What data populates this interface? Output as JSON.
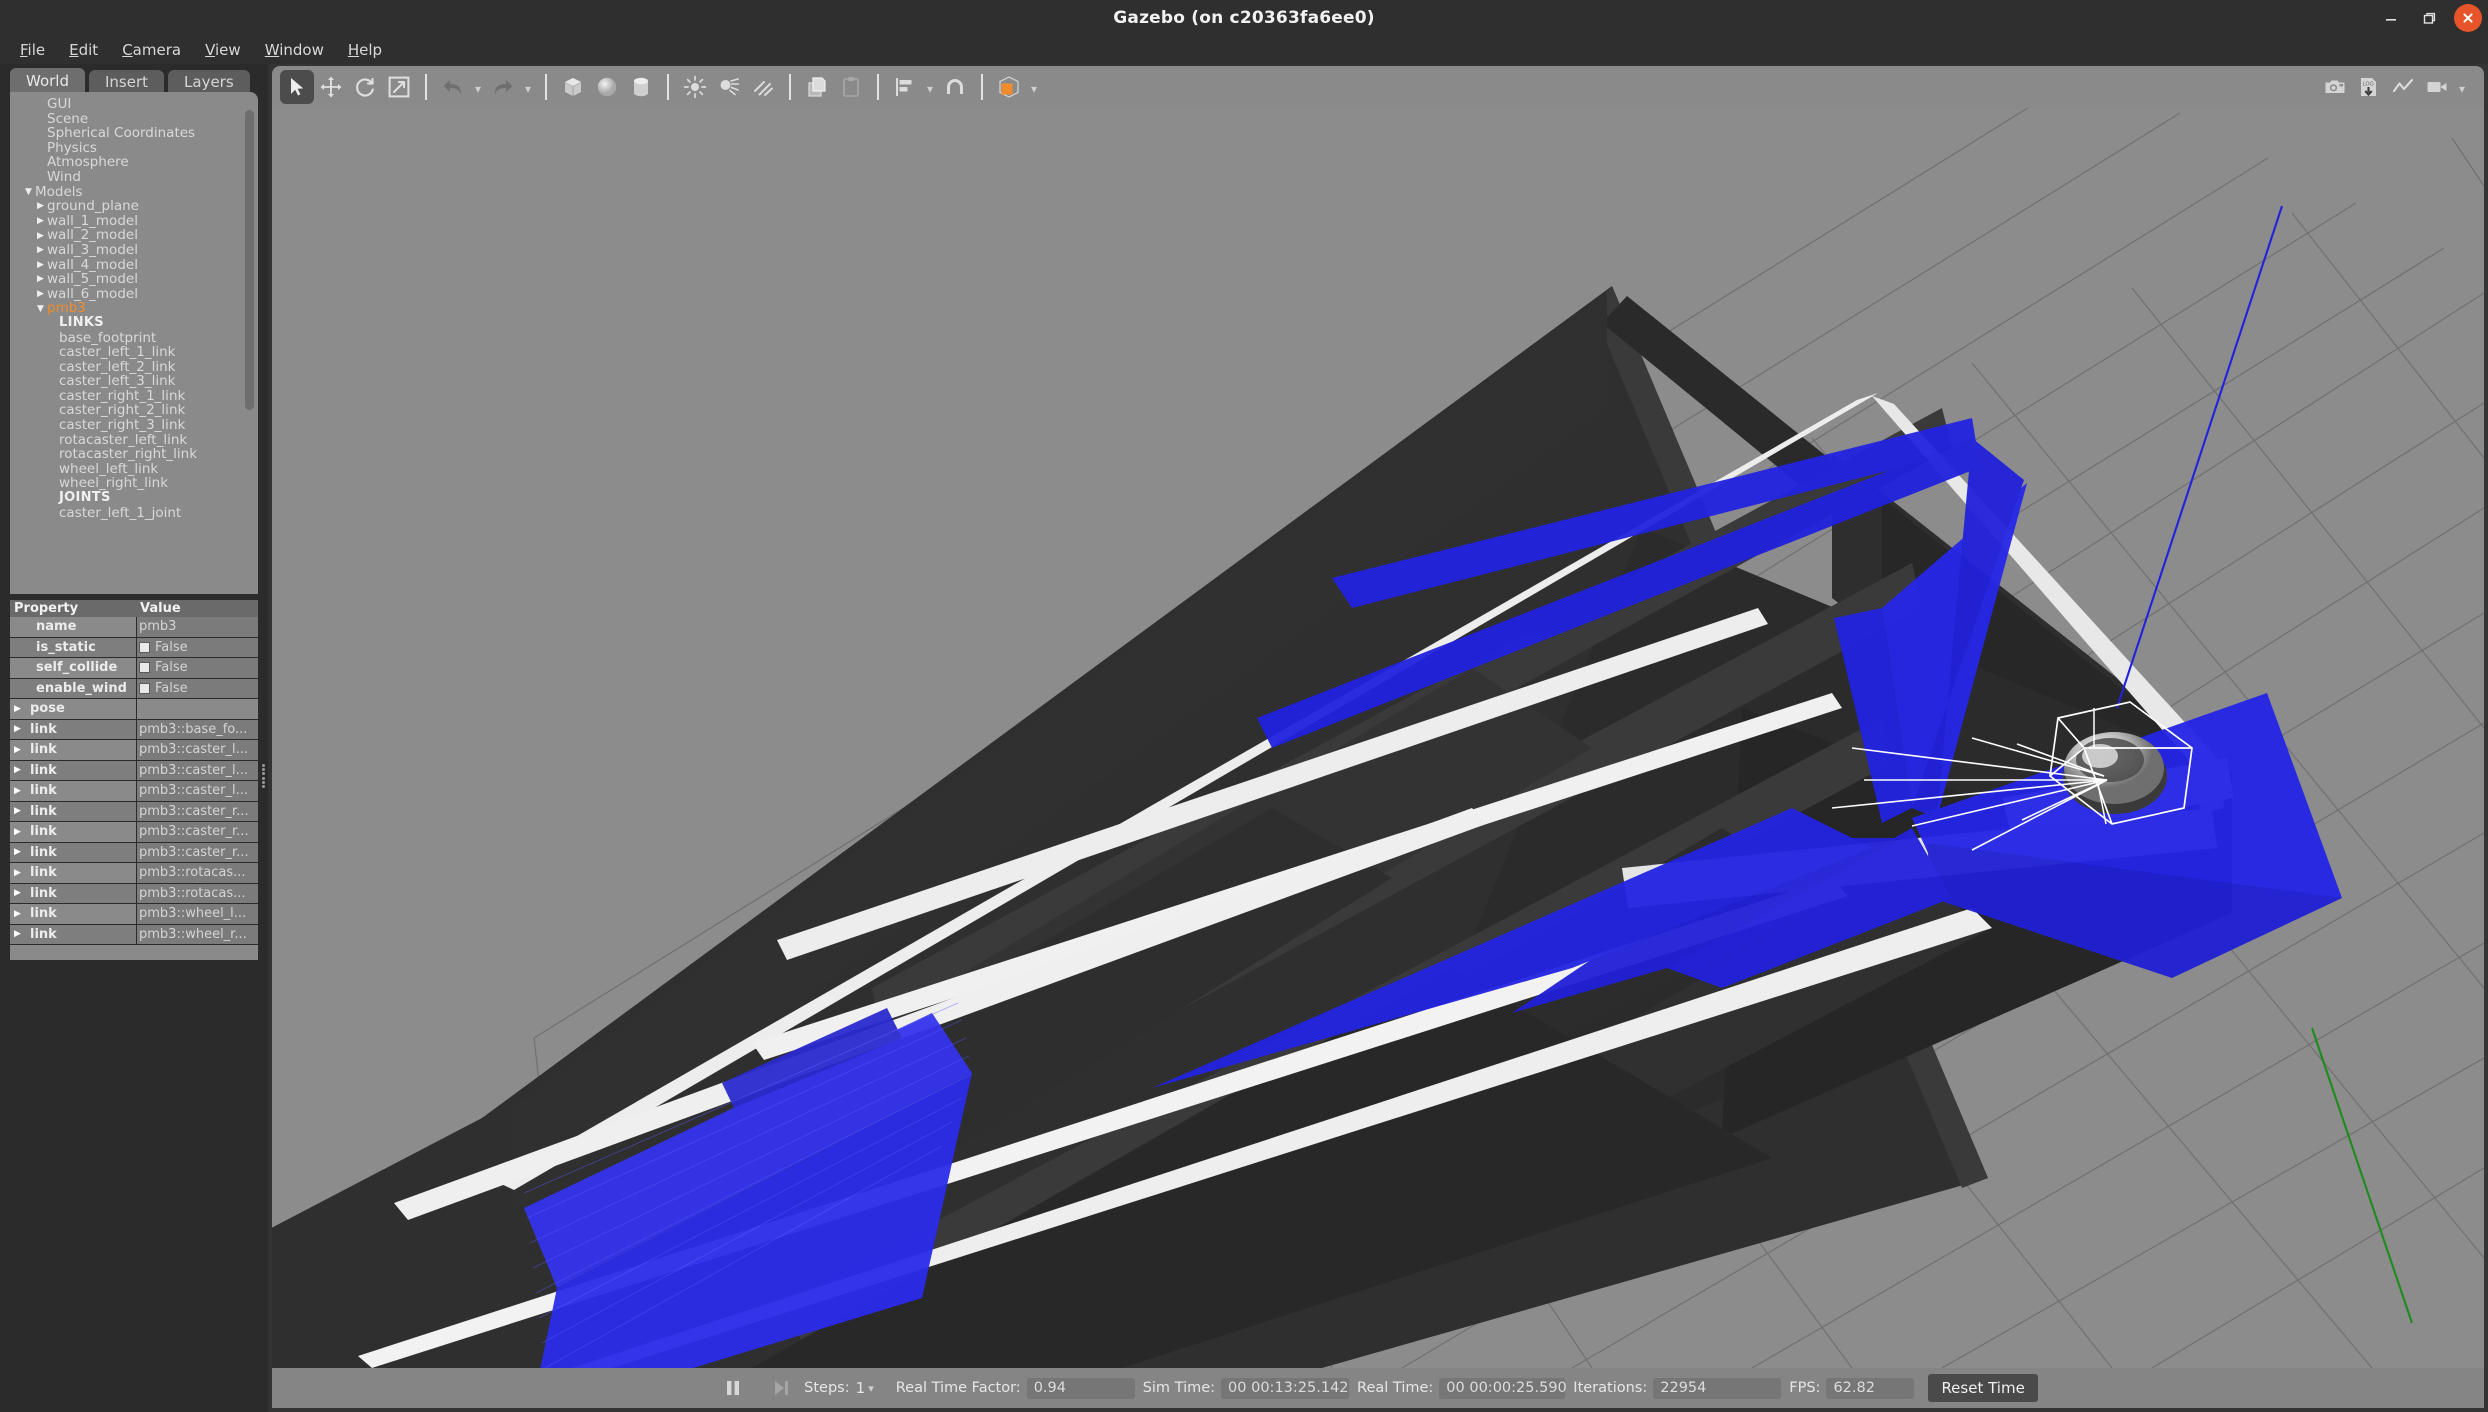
{
  "window": {
    "title": "Gazebo (on c20363fa6ee0)",
    "minimize_label": "minimize",
    "maximize_label": "maximize",
    "close_label": "close"
  },
  "menubar": {
    "items": [
      {
        "label": "File",
        "mnemonic": "F"
      },
      {
        "label": "Edit",
        "mnemonic": "E"
      },
      {
        "label": "Camera",
        "mnemonic": "C"
      },
      {
        "label": "View",
        "mnemonic": "V"
      },
      {
        "label": "Window",
        "mnemonic": "W"
      },
      {
        "label": "Help",
        "mnemonic": "H"
      }
    ]
  },
  "left_panel": {
    "tabs": [
      {
        "label": "World",
        "active": true
      },
      {
        "label": "Insert",
        "active": false
      },
      {
        "label": "Layers",
        "active": false
      }
    ],
    "tree": [
      {
        "label": "GUI",
        "indent": 1,
        "arrow": "none",
        "selected": false,
        "header": false
      },
      {
        "label": "Scene",
        "indent": 1,
        "arrow": "none",
        "selected": false,
        "header": false
      },
      {
        "label": "Spherical Coordinates",
        "indent": 1,
        "arrow": "none",
        "selected": false,
        "header": false
      },
      {
        "label": "Physics",
        "indent": 1,
        "arrow": "none",
        "selected": false,
        "header": false
      },
      {
        "label": "Atmosphere",
        "indent": 1,
        "arrow": "none",
        "selected": false,
        "header": false
      },
      {
        "label": "Wind",
        "indent": 1,
        "arrow": "none",
        "selected": false,
        "header": false
      },
      {
        "label": "Models",
        "indent": 0,
        "arrow": "down",
        "selected": false,
        "header": false
      },
      {
        "label": "ground_plane",
        "indent": 1,
        "arrow": "right",
        "selected": false,
        "header": false
      },
      {
        "label": "wall_1_model",
        "indent": 1,
        "arrow": "right",
        "selected": false,
        "header": false
      },
      {
        "label": "wall_2_model",
        "indent": 1,
        "arrow": "right",
        "selected": false,
        "header": false
      },
      {
        "label": "wall_3_model",
        "indent": 1,
        "arrow": "right",
        "selected": false,
        "header": false
      },
      {
        "label": "wall_4_model",
        "indent": 1,
        "arrow": "right",
        "selected": false,
        "header": false
      },
      {
        "label": "wall_5_model",
        "indent": 1,
        "arrow": "right",
        "selected": false,
        "header": false
      },
      {
        "label": "wall_6_model",
        "indent": 1,
        "arrow": "right",
        "selected": false,
        "header": false
      },
      {
        "label": "pmb3",
        "indent": 1,
        "arrow": "down",
        "selected": true,
        "header": false
      },
      {
        "label": "LINKS",
        "indent": 2,
        "arrow": "none",
        "selected": false,
        "header": true
      },
      {
        "label": "base_footprint",
        "indent": 2,
        "arrow": "none",
        "selected": false,
        "header": false
      },
      {
        "label": "caster_left_1_link",
        "indent": 2,
        "arrow": "none",
        "selected": false,
        "header": false
      },
      {
        "label": "caster_left_2_link",
        "indent": 2,
        "arrow": "none",
        "selected": false,
        "header": false
      },
      {
        "label": "caster_left_3_link",
        "indent": 2,
        "arrow": "none",
        "selected": false,
        "header": false
      },
      {
        "label": "caster_right_1_link",
        "indent": 2,
        "arrow": "none",
        "selected": false,
        "header": false
      },
      {
        "label": "caster_right_2_link",
        "indent": 2,
        "arrow": "none",
        "selected": false,
        "header": false
      },
      {
        "label": "caster_right_3_link",
        "indent": 2,
        "arrow": "none",
        "selected": false,
        "header": false
      },
      {
        "label": "rotacaster_left_link",
        "indent": 2,
        "arrow": "none",
        "selected": false,
        "header": false
      },
      {
        "label": "rotacaster_right_link",
        "indent": 2,
        "arrow": "none",
        "selected": false,
        "header": false
      },
      {
        "label": "wheel_left_link",
        "indent": 2,
        "arrow": "none",
        "selected": false,
        "header": false
      },
      {
        "label": "wheel_right_link",
        "indent": 2,
        "arrow": "none",
        "selected": false,
        "header": false
      },
      {
        "label": "JOINTS",
        "indent": 2,
        "arrow": "none",
        "selected": false,
        "header": true
      },
      {
        "label": "caster_left_1_joint",
        "indent": 2,
        "arrow": "none",
        "selected": false,
        "header": false
      }
    ]
  },
  "property_table": {
    "columns": [
      "Property",
      "Value"
    ],
    "rows": [
      {
        "key": "name",
        "value": "pmb3",
        "checkbox": false,
        "twisty": false,
        "indent": true
      },
      {
        "key": "is_static",
        "value": "False",
        "checkbox": true,
        "twisty": false,
        "indent": true
      },
      {
        "key": "self_collide",
        "value": "False",
        "checkbox": true,
        "twisty": false,
        "indent": true
      },
      {
        "key": "enable_wind",
        "value": "False",
        "checkbox": true,
        "twisty": false,
        "indent": true
      },
      {
        "key": "pose",
        "value": "",
        "checkbox": false,
        "twisty": true,
        "indent": false
      },
      {
        "key": "link",
        "value": "pmb3::base_fo...",
        "checkbox": false,
        "twisty": true,
        "indent": false
      },
      {
        "key": "link",
        "value": "pmb3::caster_l...",
        "checkbox": false,
        "twisty": true,
        "indent": false
      },
      {
        "key": "link",
        "value": "pmb3::caster_l...",
        "checkbox": false,
        "twisty": true,
        "indent": false
      },
      {
        "key": "link",
        "value": "pmb3::caster_l...",
        "checkbox": false,
        "twisty": true,
        "indent": false
      },
      {
        "key": "link",
        "value": "pmb3::caster_r...",
        "checkbox": false,
        "twisty": true,
        "indent": false
      },
      {
        "key": "link",
        "value": "pmb3::caster_r...",
        "checkbox": false,
        "twisty": true,
        "indent": false
      },
      {
        "key": "link",
        "value": "pmb3::caster_r...",
        "checkbox": false,
        "twisty": true,
        "indent": false
      },
      {
        "key": "link",
        "value": "pmb3::rotacas...",
        "checkbox": false,
        "twisty": true,
        "indent": false
      },
      {
        "key": "link",
        "value": "pmb3::rotacas...",
        "checkbox": false,
        "twisty": true,
        "indent": false
      },
      {
        "key": "link",
        "value": "pmb3::wheel_l...",
        "checkbox": false,
        "twisty": true,
        "indent": false
      },
      {
        "key": "link",
        "value": "pmb3::wheel_r...",
        "checkbox": false,
        "twisty": true,
        "indent": false
      }
    ]
  },
  "toolbar": {
    "left_tools": [
      {
        "icon": "select-arrow-icon",
        "active": true,
        "enabled": true
      },
      {
        "icon": "translate-icon",
        "active": false,
        "enabled": true
      },
      {
        "icon": "rotate-icon",
        "active": false,
        "enabled": true
      },
      {
        "icon": "scale-icon",
        "active": false,
        "enabled": true
      }
    ],
    "history_tools": [
      {
        "icon": "undo-icon",
        "enabled": false
      },
      {
        "icon": "redo-icon",
        "enabled": false
      }
    ],
    "shape_tools": [
      {
        "icon": "box-icon"
      },
      {
        "icon": "sphere-icon"
      },
      {
        "icon": "cylinder-icon"
      }
    ],
    "light_tools": [
      {
        "icon": "point-light-icon"
      },
      {
        "icon": "spot-light-icon"
      },
      {
        "icon": "directional-light-icon"
      }
    ],
    "clipboard_tools": [
      {
        "icon": "copy-icon"
      },
      {
        "icon": "paste-icon"
      }
    ],
    "align_tools": [
      {
        "icon": "align-icon"
      },
      {
        "icon": "snap-magnet-icon"
      }
    ],
    "view_tools": [
      {
        "icon": "view-angle-cube-icon"
      }
    ],
    "right_tools": [
      {
        "icon": "screenshot-camera-icon"
      },
      {
        "icon": "log-record-icon"
      },
      {
        "icon": "plot-icon"
      },
      {
        "icon": "video-record-icon"
      }
    ]
  },
  "statusbar": {
    "play_pause_icon": "pause-icon",
    "step_icon": "step-forward-icon",
    "steps_label": "Steps:",
    "steps_value": "1",
    "real_time_factor_label": "Real Time Factor:",
    "real_time_factor_value": "0.94",
    "sim_time_label": "Sim Time:",
    "sim_time_value": "00 00:13:25.142",
    "real_time_label": "Real Time:",
    "real_time_value": "00 00:00:25.590",
    "iterations_label": "Iterations:",
    "iterations_value": "22954",
    "fps_label": "FPS:",
    "fps_value": "62.82",
    "reset_time_label": "Reset Time"
  },
  "scene": {
    "description": "3D Gazebo viewport: gray ground plane with grid, dark corridor/maze walls with white top caps, a selected mobile robot (pmb3) with white selection bounding box, and blue laser scan fan visualization.",
    "colors": {
      "ground": "#8c8c8c",
      "grid_line": "#6d6d6d",
      "wall_side_dark": "#2d2d2d",
      "wall_side_darker": "#262626",
      "wall_top": "#ededed",
      "laser_blue": "#2020e8",
      "selection_white": "#ffffff",
      "axis_blue": "#2222dd",
      "axis_green": "#22aa22"
    }
  }
}
